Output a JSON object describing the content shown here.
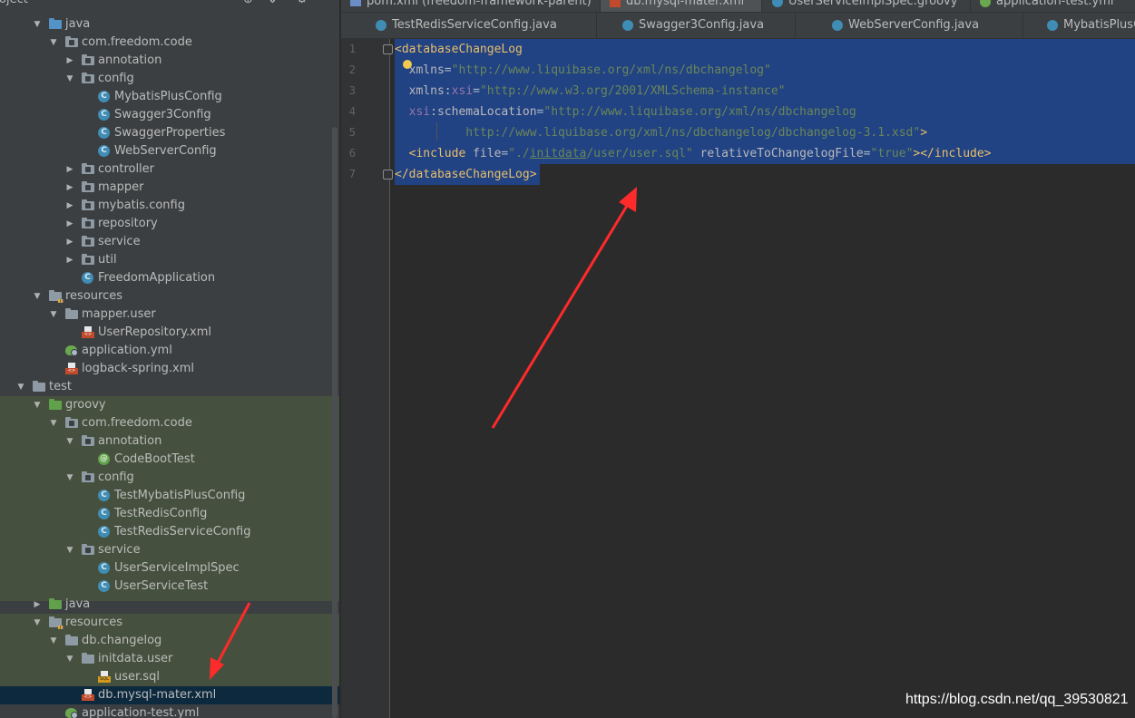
{
  "project_panel": {
    "title": "roject",
    "toolbar": [
      "⊕",
      "⇕",
      "⚙",
      "—"
    ],
    "tree": [
      {
        "label": "java",
        "icon": "folder-blue-icon",
        "level": 1,
        "expanded": true
      },
      {
        "label": "com.freedom.code",
        "icon": "package-icon",
        "level": 2,
        "expanded": true
      },
      {
        "label": "annotation",
        "icon": "package-icon",
        "level": 3,
        "expanded": false
      },
      {
        "label": "config",
        "icon": "package-icon",
        "level": 3,
        "expanded": true
      },
      {
        "label": "MybatisPlusConfig",
        "icon": "class-icon",
        "level": 4
      },
      {
        "label": "Swagger3Config",
        "icon": "class-icon",
        "level": 4
      },
      {
        "label": "SwaggerProperties",
        "icon": "class-icon",
        "level": 4
      },
      {
        "label": "WebServerConfig",
        "icon": "class-icon",
        "level": 4
      },
      {
        "label": "controller",
        "icon": "package-icon",
        "level": 3,
        "expanded": false
      },
      {
        "label": "mapper",
        "icon": "package-icon",
        "level": 3,
        "expanded": false
      },
      {
        "label": "mybatis.config",
        "icon": "package-icon",
        "level": 3,
        "expanded": false
      },
      {
        "label": "repository",
        "icon": "package-icon",
        "level": 3,
        "expanded": false
      },
      {
        "label": "service",
        "icon": "package-icon",
        "level": 3,
        "expanded": false
      },
      {
        "label": "util",
        "icon": "package-icon",
        "level": 3,
        "expanded": false
      },
      {
        "label": "FreedomApplication",
        "icon": "spring-class-icon",
        "level": 3
      },
      {
        "label": "resources",
        "icon": "resources-folder-icon",
        "level": 1,
        "expanded": true
      },
      {
        "label": "mapper.user",
        "icon": "folder-icon",
        "level": 2,
        "expanded": true
      },
      {
        "label": "UserRepository.xml",
        "icon": "xml-file-icon",
        "level": 3
      },
      {
        "label": "application.yml",
        "icon": "yaml-file-icon",
        "level": 2
      },
      {
        "label": "logback-spring.xml",
        "icon": "xml-file-icon",
        "level": 2
      },
      {
        "label": "test",
        "icon": "folder-icon",
        "level": 0,
        "expanded": true
      },
      {
        "label": "groovy",
        "icon": "folder-green-icon",
        "level": 1,
        "expanded": true
      },
      {
        "label": "com.freedom.code",
        "icon": "package-icon",
        "level": 2,
        "expanded": true
      },
      {
        "label": "annotation",
        "icon": "package-icon",
        "level": 3,
        "expanded": true
      },
      {
        "label": "CodeBootTest",
        "icon": "annotation-icon",
        "level": 4
      },
      {
        "label": "config",
        "icon": "package-icon",
        "level": 3,
        "expanded": true
      },
      {
        "label": "TestMybatisPlusConfig",
        "icon": "class-icon",
        "level": 4
      },
      {
        "label": "TestRedisConfig",
        "icon": "class-icon",
        "level": 4
      },
      {
        "label": "TestRedisServiceConfig",
        "icon": "class-icon",
        "level": 4
      },
      {
        "label": "service",
        "icon": "package-icon",
        "level": 3,
        "expanded": true
      },
      {
        "label": "UserServiceImplSpec",
        "icon": "groovy-class-icon",
        "level": 4
      },
      {
        "label": "UserServiceTest",
        "icon": "class-icon",
        "level": 4
      },
      {
        "label": "java",
        "icon": "folder-green-icon",
        "level": 1,
        "expanded": false
      },
      {
        "label": "resources",
        "icon": "resources-folder-icon",
        "level": 1,
        "expanded": true
      },
      {
        "label": "db.changelog",
        "icon": "folder-icon",
        "level": 2,
        "expanded": true
      },
      {
        "label": "initdata.user",
        "icon": "folder-icon",
        "level": 3,
        "expanded": true
      },
      {
        "label": "user.sql",
        "icon": "sql-file-icon",
        "level": 4
      },
      {
        "label": "db.mysql-mater.xml",
        "icon": "xml-file-icon",
        "level": 3,
        "selected": true
      },
      {
        "label": "application-test.yml",
        "icon": "yaml-file-icon",
        "level": 2
      }
    ]
  },
  "editor": {
    "tabs_row1": [
      {
        "label": "pom.xml (freedom-framework-parent)",
        "icon": "maven-icon",
        "active": false
      },
      {
        "label": "db.mysql-mater.xml",
        "icon": "xml-file-icon",
        "active": true
      },
      {
        "label": "UserServiceImplSpec.groovy",
        "icon": "groovy-class-icon",
        "active": false
      },
      {
        "label": "application-test.yml",
        "icon": "yaml-file-icon",
        "active": false
      }
    ],
    "tabs_row2": [
      {
        "label": "TestRedisServiceConfig.java",
        "icon": "class-icon",
        "active": false
      },
      {
        "label": "Swagger3Config.java",
        "icon": "class-icon",
        "active": false
      },
      {
        "label": "WebServerConfig.java",
        "icon": "class-icon",
        "active": false
      },
      {
        "label": "MybatisPlusCo",
        "icon": "class-icon",
        "active": false
      }
    ],
    "line_numbers": [
      "1",
      "2",
      "3",
      "4",
      "5",
      "6",
      "7"
    ],
    "code": {
      "l1_tag": "<databaseChangeLog",
      "l2_attr": "xmlns",
      "l2_val": "\"http://www.liquibase.org/xml/ns/dbchangelog\"",
      "l3_attr": "xmlns:",
      "l3_ns": "xsi",
      "l3_val": "\"http://www.w3.org/2001/XMLSchema-instance\"",
      "l4_ns": "xsi",
      "l4_attr": ":schemaLocation",
      "l4_val": "\"http://www.liquibase.org/xml/ns/dbchangelog",
      "l5_val": "http://www.liquibase.org/xml/ns/dbchangelog/dbchangelog-3.1.xsd\"",
      "l5_tag": ">",
      "l6_tag_open": "<include ",
      "l6_attr1": "file",
      "l6_val1a": "\"./",
      "l6_val1b": "initdata",
      "l6_val1c": "/user/user.sql\"",
      "l6_attr2": " relativeToChangelogFile",
      "l6_val2": "\"true\"",
      "l6_tag_close": "></include>",
      "l7_tag": "</databaseChangeLog>"
    }
  },
  "watermark": "https://blog.csdn.net/qq_39530821",
  "colors": {
    "selection": "#214283",
    "annotation_arrow": "#ff2a2a",
    "tree_selected": "#0d293e",
    "test_source_bg": "#45513e"
  }
}
